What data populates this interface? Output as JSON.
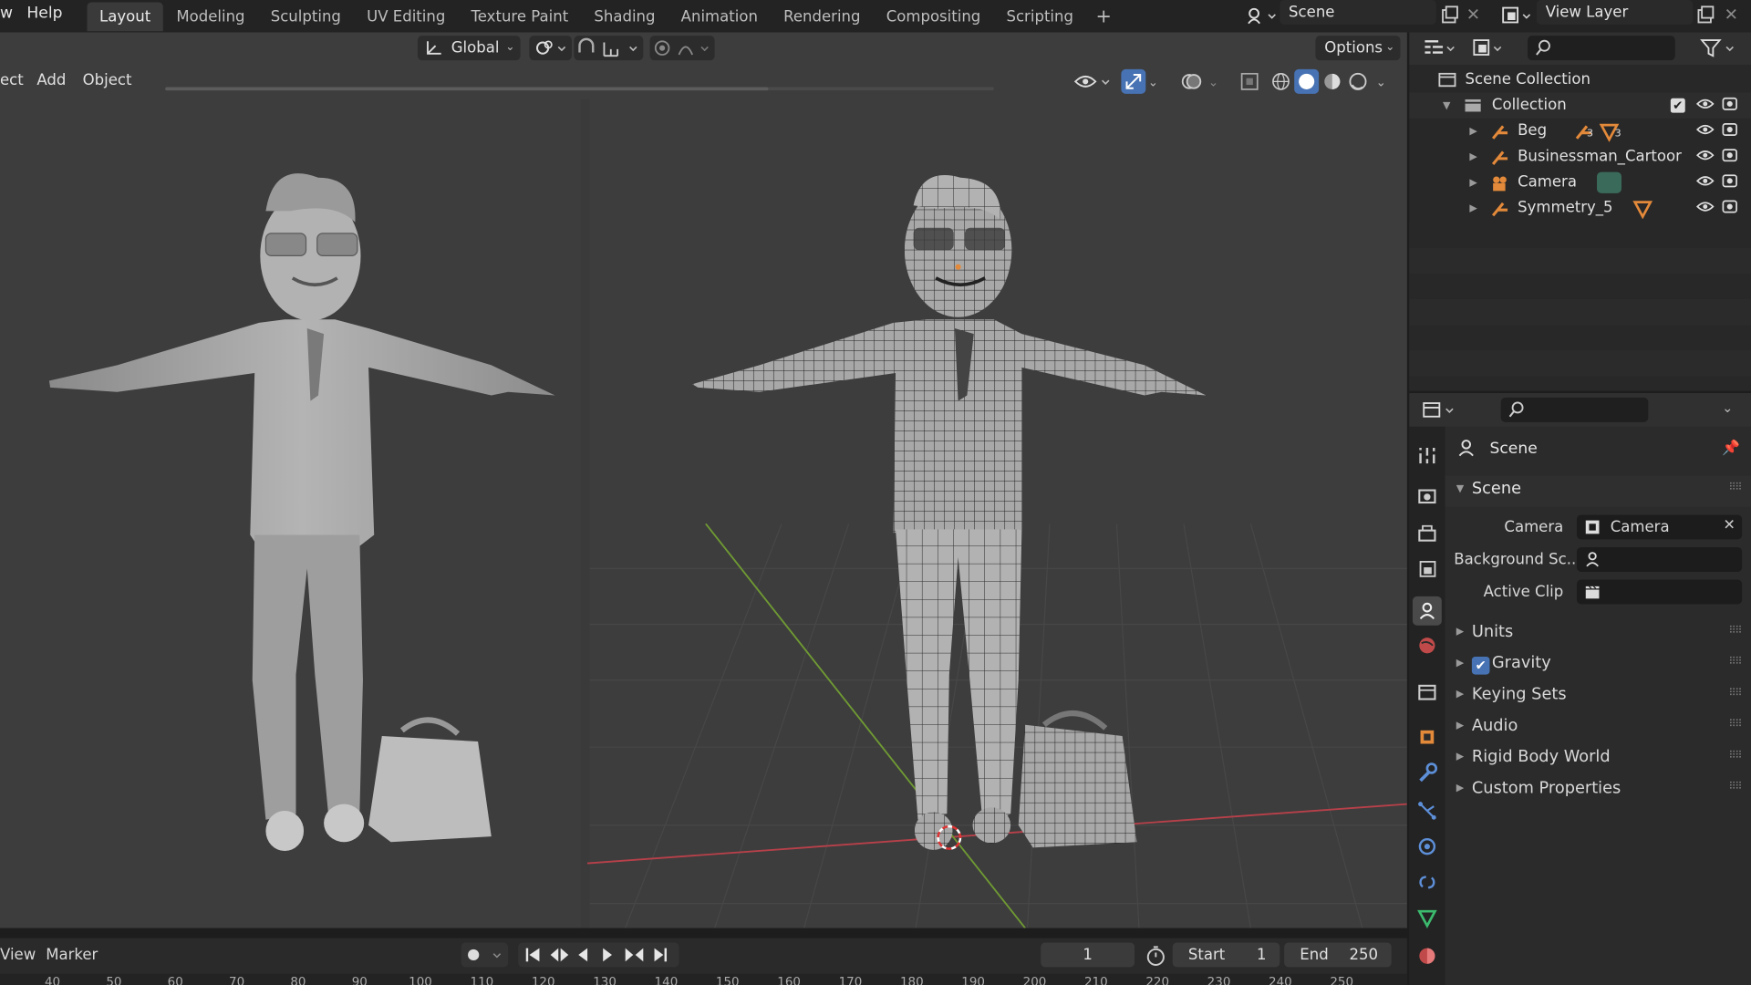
{
  "top_menu": {
    "items": [
      "w",
      "Help"
    ]
  },
  "workspace_tabs": [
    {
      "label": "Layout",
      "active": true
    },
    {
      "label": "Modeling"
    },
    {
      "label": "Sculpting"
    },
    {
      "label": "UV Editing"
    },
    {
      "label": "Texture Paint"
    },
    {
      "label": "Shading"
    },
    {
      "label": "Animation"
    },
    {
      "label": "Rendering"
    },
    {
      "label": "Compositing"
    },
    {
      "label": "Scripting"
    }
  ],
  "add_workspace": "+",
  "scene_selector": {
    "value": "Scene"
  },
  "view_layer_selector": {
    "value": "View Layer"
  },
  "viewport": {
    "transform_orientation": "Global",
    "options_label": "Options",
    "menus": [
      "ect",
      "Add",
      "Object"
    ]
  },
  "outliner": {
    "root": "Scene Collection",
    "collection": "Collection",
    "items": [
      {
        "label": "Beg",
        "badge1": "3",
        "badge2": "3"
      },
      {
        "label": "Businessman_Cartoor"
      },
      {
        "label": "Camera"
      },
      {
        "label": "Symmetry_5"
      }
    ]
  },
  "properties": {
    "context_title": "Scene",
    "panel_title": "Scene",
    "camera_label": "Camera",
    "camera_value": "Camera",
    "background_label": "Background Sc...",
    "active_clip_label": "Active Clip",
    "sections": [
      "Units",
      "Gravity",
      "Keying Sets",
      "Audio",
      "Rigid Body World",
      "Custom Properties"
    ],
    "gravity_checked": true
  },
  "timeline": {
    "menus": [
      "View",
      "Marker"
    ],
    "current_frame": "1",
    "start_label": "Start",
    "start_value": "1",
    "end_label": "End",
    "end_value": "250",
    "ruler": [
      "40",
      "50",
      "60",
      "70",
      "80",
      "90",
      "100",
      "110",
      "120",
      "130",
      "140",
      "150",
      "160",
      "170",
      "180",
      "190",
      "200",
      "210",
      "220",
      "230",
      "240",
      "250"
    ]
  },
  "colors": {
    "accent": "#4772b3",
    "header": "#3d3d3d",
    "panel": "#2b2b2b",
    "x_axis": "#c2404a",
    "y_axis": "#7da43a",
    "object_orange": "#e3893a"
  }
}
